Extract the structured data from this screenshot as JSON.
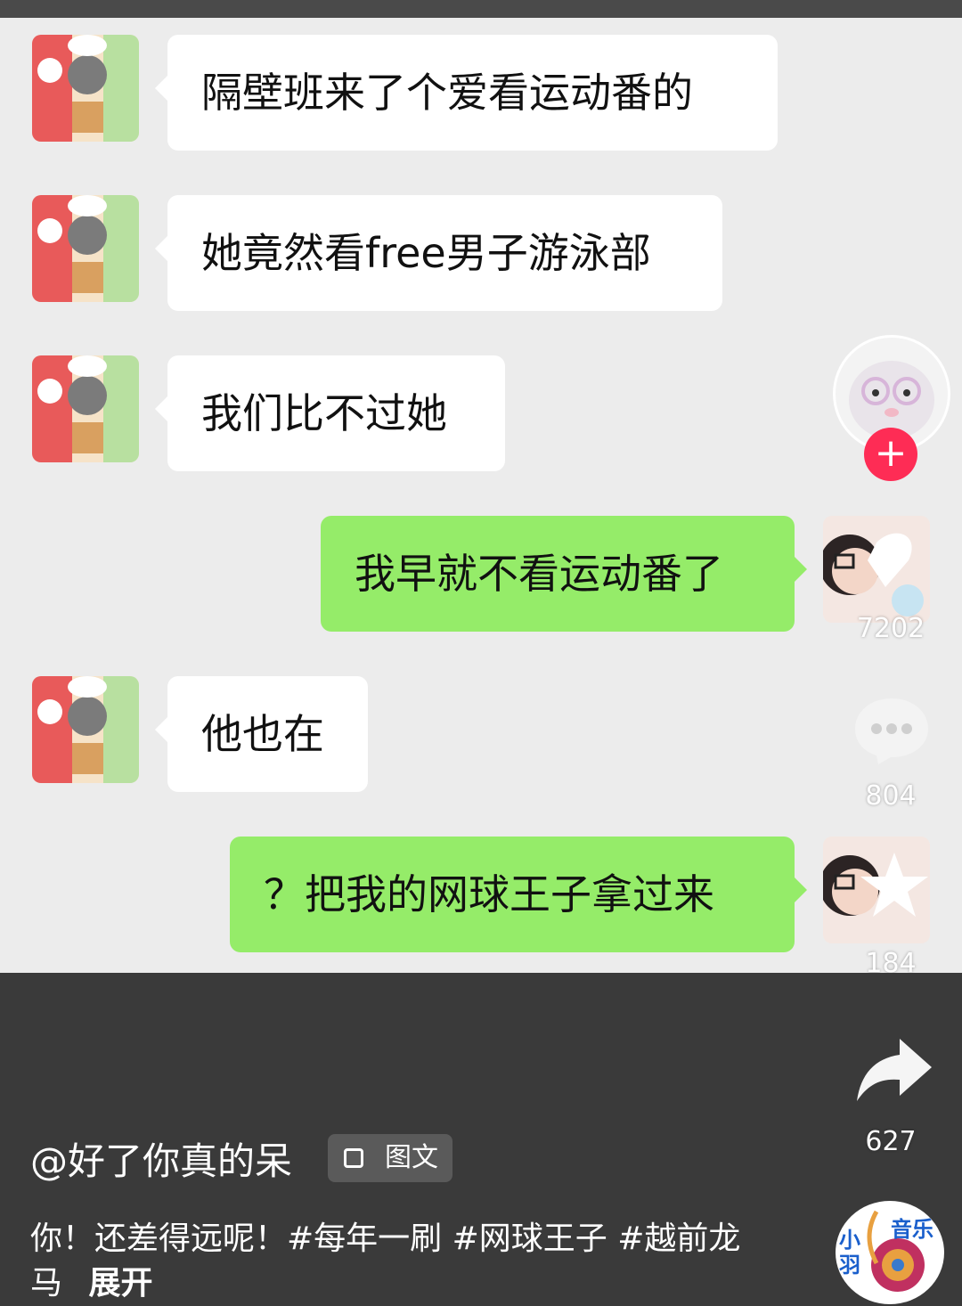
{
  "messages": [
    {
      "side": "left",
      "text": "隔壁班来了个爱看运动番的"
    },
    {
      "side": "left",
      "text": "她竟然看free男子游泳部"
    },
    {
      "side": "left",
      "text": "我们比不过她"
    },
    {
      "side": "right",
      "text": "我早就不看运动番了"
    },
    {
      "side": "left",
      "text": "他也在"
    },
    {
      "side": "right",
      "text": "？把我的网球王子拿过来"
    }
  ],
  "sidebar": {
    "likes": "7202",
    "comments": "804",
    "favorites": "184",
    "shares": "627",
    "music_label": "音乐",
    "music_logo_text": "小羽"
  },
  "post": {
    "author": "@好了你真的呆",
    "type_tag": "图文",
    "caption": "你！还差得远呢！#每年一刷 #网球王子 #越前龙马",
    "expand": "展开"
  },
  "colors": {
    "chat_bg": "#ececec",
    "bubble_left": "#ffffff",
    "bubble_right": "#95ec69",
    "follow_plus": "#fe2c55"
  }
}
